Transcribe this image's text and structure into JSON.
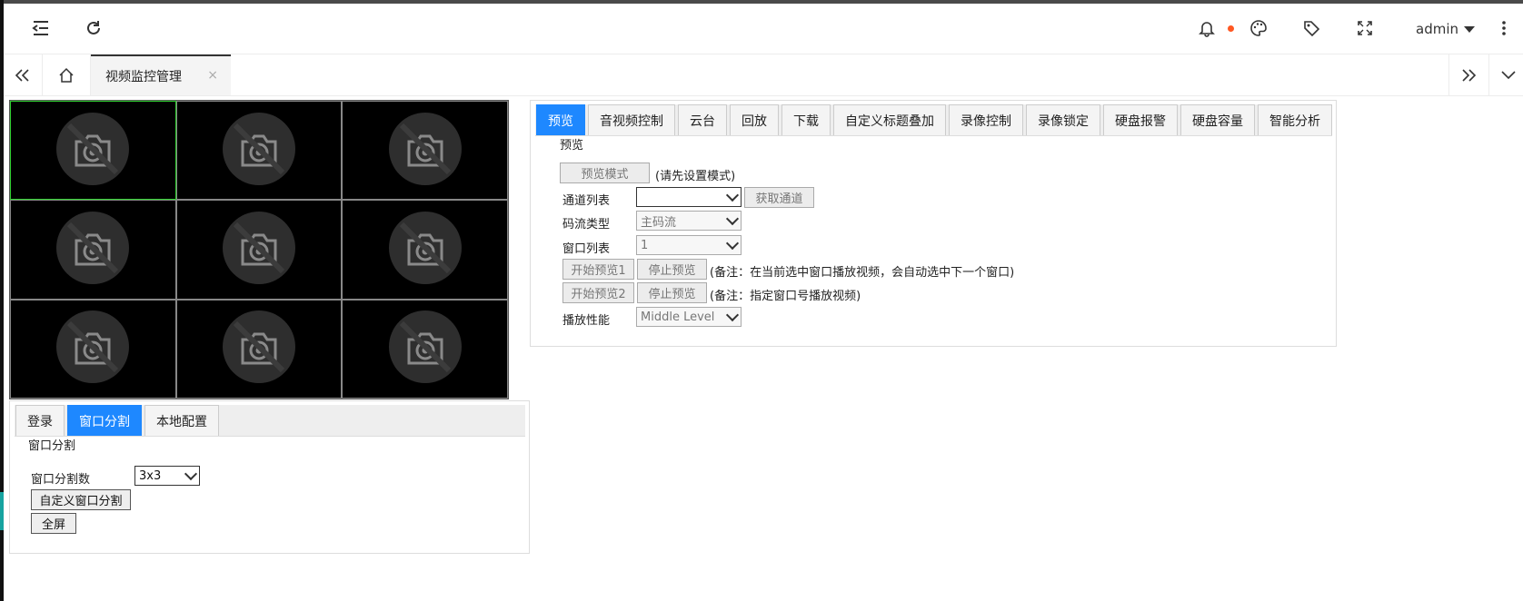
{
  "header": {
    "menu_icon": "collapse-menu-icon",
    "refresh_icon": "refresh-icon",
    "bell_icon": "bell-icon",
    "palette_icon": "palette-icon",
    "tag_icon": "tag-icon",
    "fullscreen_icon": "fullscreen-icon",
    "user": "admin",
    "more_icon": "more-vertical-icon",
    "badge_color": "#ff5722"
  },
  "tabbar": {
    "active_tab": "视频监控管理",
    "close": "×"
  },
  "video": {
    "cells": 9,
    "selected_index": 0,
    "placeholder_icon": "camera-off-icon"
  },
  "left_panel": {
    "tabs": [
      "登录",
      "窗口分割",
      "本地配置"
    ],
    "active_tab": 1,
    "section_title": "窗口分割",
    "split_label": "窗口分割数",
    "split_value": "3x3",
    "custom_split_button": "自定义窗口分割",
    "fullscreen_button": "全屏"
  },
  "right_panel": {
    "tabs": [
      "预览",
      "音视频控制",
      "云台",
      "回放",
      "下载",
      "自定义标题叠加",
      "录像控制",
      "录像锁定",
      "硬盘报警",
      "硬盘容量",
      "智能分析"
    ],
    "active_tab": 0,
    "section_title": "预览",
    "preview_mode_button": "预览模式",
    "preview_mode_note": "(请先设置模式)",
    "channel_list_label": "通道列表",
    "channel_list_value": "",
    "get_channel_button": "获取通道",
    "stream_type_label": "码流类型",
    "stream_type_value": "主码流",
    "window_list_label": "窗口列表",
    "window_list_value": "1",
    "start_preview1_button": "开始预览1",
    "stop_preview_button": "停止预览",
    "note1": "(备注：在当前选中窗口播放视频，会自动选中下一个窗口)",
    "start_preview2_button": "开始预览2",
    "stop_preview2_button": "停止预览",
    "note2": "(备注：指定窗口号播放视频)",
    "performance_label": "播放性能",
    "performance_value": "Middle Level"
  },
  "colors": {
    "active_tab": "#1e88ff",
    "selected_cell": "#30d030"
  }
}
